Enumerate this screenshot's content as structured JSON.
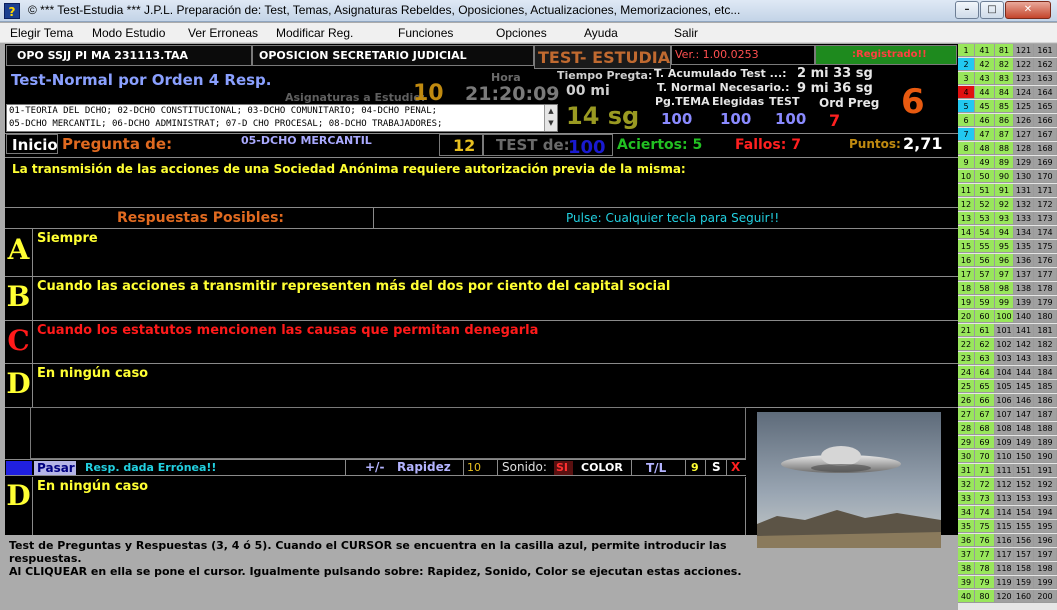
{
  "window": {
    "title": "©  *** Test-Estudia ***  J.P.L.   Preparación de: Test, Temas, Asignaturas Rebeldes, Oposiciones, Actualizaciones, Memorizaciones, etc..."
  },
  "menu": [
    "Elegir Tema",
    "Modo Estudio",
    "Ver Erroneas",
    "Modificar Reg.",
    "Funciones",
    "Opciones",
    "Ayuda",
    "Salir"
  ],
  "header": {
    "exam_code": "OPO SSJJ  PI MA 231113.TAA",
    "exam_name": "OPOSICION SECRETARIO JUDICIAL",
    "app_name": "TEST- ESTUDIA",
    "version": "Ver.: 1.00.0253",
    "registered": ":Registrado!!"
  },
  "test_info": {
    "mode": "Test-Normal por Orden 4 Resp.",
    "hora_label": "Hora",
    "hora_value": "21:20:09",
    "asignaturas_label": "Asignaturas a Estudio:",
    "asignaturas_value": "10",
    "tiempo_pregta_label": "Tiempo Pregta:",
    "tiempo_pregta_min": "00 mi",
    "tiempo_pregta_sg": "14 sg",
    "t_acumulado_label": "T. Acumulado Test ...:",
    "t_acumulado_value": "2 mi  33 sg",
    "t_normal_label": "T. Normal Necesario.:",
    "t_normal_value": "9 mi  36 sg",
    "pg_tema_label": "Pg.TEMA",
    "elegidas_label": "Elegidas",
    "test_label": "TEST",
    "pg_tema_value": "100",
    "elegidas_value": "100",
    "test_value": "100",
    "ord_preg_label": "Ord Preg",
    "ord_preg_value": "7",
    "big_number": "6",
    "subjects": [
      "01-TEORIA DEL DCHO; 02-DCHO CONSTITUCIONAL; 03-DCHO COMUNITARIO; 04-DCHO PENAL;",
      "05-DCHO MERCANTIL; 06-DCHO ADMINISTRAT; 07-D CHO PROCESAL; 08-DCHO TRABAJADORES;"
    ]
  },
  "question_bar": {
    "inicio": "Inicio",
    "pregunta_de": "Pregunta de:",
    "subject": "05-DCHO MERCANTIL",
    "question_number": "12",
    "test_de_label": "TEST de:",
    "test_de_value": "100",
    "aciertos": "Aciertos: 5",
    "fallos": "Fallos: 7",
    "puntos_label": "Puntos:",
    "puntos_value": "2,71"
  },
  "question": "La transmisión de las acciones de una Sociedad Anónima requiere autorización previa de la misma:",
  "responses_header": "Respuestas Posibles:",
  "pulse_hint": "Pulse:  Cualquier tecla para Seguir!!",
  "options": [
    {
      "letter": "A",
      "text": "Siempre",
      "color": "#ffff33"
    },
    {
      "letter": "B",
      "text": "Cuando las acciones a transmitir representen más del dos por ciento del capital social",
      "color": "#ffff33"
    },
    {
      "letter": "C",
      "text": "Cuando los estatutos mencionen las causas que permitan denegarla",
      "color": "#ff1a1a"
    },
    {
      "letter": "D",
      "text": "En ningún caso",
      "color": "#ffff33"
    }
  ],
  "controls": {
    "pasar": "Pasar",
    "resp_dada": "Resp. dada  Errónea!!",
    "plus_minus": "+/-",
    "rapidez_label": "Rapidez",
    "rapidez_value": "10",
    "sonido_label": "Sonido:",
    "sonido_value": "SI",
    "color_label": "COLOR",
    "tl_label": "T/L",
    "tl_value": "9",
    "s_label": "S",
    "x_label": "X"
  },
  "answer": {
    "letter": "D",
    "text": "En ningún caso"
  },
  "footer": [
    "Test de Preguntas y Respuestas (3, 4 ó 5). Cuando el CURSOR se encuentra en la casilla azul, permite introducir las",
    "respuestas.",
    "Al CLIQUEAR en ella se pone el cursor. Igualmente pulsando sobre: Rapidez, Sonido, Color se ejecutan estas acciones."
  ],
  "grid_colors": {
    "answered": "#99e65c",
    "current": "#22c8f0",
    "failed": "#e01010",
    "pending": "#a0a0a0",
    "neutral": "#e8e8e8"
  },
  "grid_rows": [
    {
      "cells": [
        "1",
        "41",
        "81",
        "121",
        "161"
      ],
      "c1": "answered"
    },
    {
      "cells": [
        "2",
        "42",
        "82",
        "122",
        "162"
      ],
      "c1": "current"
    },
    {
      "cells": [
        "3",
        "43",
        "83",
        "123",
        "163"
      ],
      "c1": "answered"
    },
    {
      "cells": [
        "4",
        "44",
        "84",
        "124",
        "164"
      ],
      "c1": "failed"
    },
    {
      "cells": [
        "5",
        "45",
        "85",
        "125",
        "165"
      ],
      "c1": "current"
    },
    {
      "cells": [
        "6",
        "46",
        "86",
        "126",
        "166"
      ],
      "c1": "answered"
    },
    {
      "cells": [
        "7",
        "47",
        "87",
        "127",
        "167"
      ],
      "c1": "current"
    },
    {
      "cells": [
        "8",
        "48",
        "88",
        "128",
        "168"
      ],
      "c1": "answered"
    },
    {
      "cells": [
        "9",
        "49",
        "89",
        "129",
        "169"
      ],
      "c1": "answered"
    },
    {
      "cells": [
        "10",
        "50",
        "90",
        "130",
        "170"
      ],
      "c1": "answered"
    },
    {
      "cells": [
        "11",
        "51",
        "91",
        "131",
        "171"
      ],
      "c1": "answered"
    },
    {
      "cells": [
        "12",
        "52",
        "92",
        "132",
        "172"
      ],
      "c1": "answered"
    },
    {
      "cells": [
        "13",
        "53",
        "93",
        "133",
        "173"
      ],
      "c1": "answered"
    },
    {
      "cells": [
        "14",
        "54",
        "94",
        "134",
        "174"
      ],
      "c1": "answered"
    },
    {
      "cells": [
        "15",
        "55",
        "95",
        "135",
        "175"
      ],
      "c1": "answered"
    },
    {
      "cells": [
        "16",
        "56",
        "96",
        "136",
        "176"
      ],
      "c1": "answered"
    },
    {
      "cells": [
        "17",
        "57",
        "97",
        "137",
        "177"
      ],
      "c1": "answered"
    },
    {
      "cells": [
        "18",
        "58",
        "98",
        "138",
        "178"
      ],
      "c1": "answered"
    },
    {
      "cells": [
        "19",
        "59",
        "99",
        "139",
        "179"
      ],
      "c1": "answered"
    },
    {
      "cells": [
        "20",
        "60",
        "100",
        "140",
        "180"
      ],
      "c1": "answered"
    },
    {
      "cells": [
        "21",
        "61",
        "101",
        "141",
        "181"
      ],
      "c1": "answered"
    },
    {
      "cells": [
        "22",
        "62",
        "102",
        "142",
        "182"
      ],
      "c1": "answered"
    },
    {
      "cells": [
        "23",
        "63",
        "103",
        "143",
        "183"
      ],
      "c1": "answered"
    },
    {
      "cells": [
        "24",
        "64",
        "104",
        "144",
        "184"
      ],
      "c1": "answered"
    },
    {
      "cells": [
        "25",
        "65",
        "105",
        "145",
        "185"
      ],
      "c1": "answered"
    },
    {
      "cells": [
        "26",
        "66",
        "106",
        "146",
        "186"
      ],
      "c1": "answered"
    },
    {
      "cells": [
        "27",
        "67",
        "107",
        "147",
        "187"
      ],
      "c1": "answered"
    },
    {
      "cells": [
        "28",
        "68",
        "108",
        "148",
        "188"
      ],
      "c1": "answered"
    },
    {
      "cells": [
        "29",
        "69",
        "109",
        "149",
        "189"
      ],
      "c1": "answered"
    },
    {
      "cells": [
        "30",
        "70",
        "110",
        "150",
        "190"
      ],
      "c1": "answered"
    },
    {
      "cells": [
        "31",
        "71",
        "111",
        "151",
        "191"
      ],
      "c1": "answered"
    },
    {
      "cells": [
        "32",
        "72",
        "112",
        "152",
        "192"
      ],
      "c1": "answered"
    },
    {
      "cells": [
        "33",
        "73",
        "113",
        "153",
        "193"
      ],
      "c1": "answered"
    },
    {
      "cells": [
        "34",
        "74",
        "114",
        "154",
        "194"
      ],
      "c1": "answered"
    },
    {
      "cells": [
        "35",
        "75",
        "115",
        "155",
        "195"
      ],
      "c1": "answered"
    },
    {
      "cells": [
        "36",
        "76",
        "116",
        "156",
        "196"
      ],
      "c1": "answered"
    },
    {
      "cells": [
        "37",
        "77",
        "117",
        "157",
        "197"
      ],
      "c1": "answered"
    },
    {
      "cells": [
        "38",
        "78",
        "118",
        "158",
        "198"
      ],
      "c1": "answered"
    },
    {
      "cells": [
        "39",
        "79",
        "119",
        "159",
        "199"
      ],
      "c1": "answered"
    },
    {
      "cells": [
        "40",
        "80",
        "120",
        "160",
        "200"
      ],
      "c1": "answered"
    }
  ]
}
